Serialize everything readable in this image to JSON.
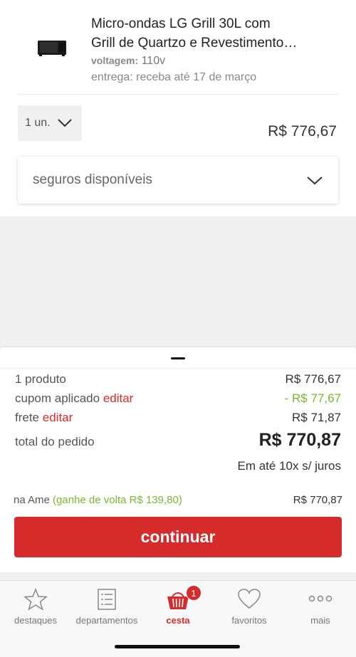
{
  "product": {
    "name_line1": "Micro-ondas LG Grill 30L com",
    "name_line2": "Grill de Quartzo e Revestimento…",
    "voltage_label": "voltagem:",
    "voltage_value": "110v",
    "delivery": "entrega: receba até 17 de março",
    "thumb_icon": "microwave-image",
    "quantity": "1 un.",
    "price": "R$ 776,67"
  },
  "insurance": {
    "label": "seguros disponíveis"
  },
  "summary": {
    "products_label": "1 produto",
    "products_value": "R$ 776,67",
    "coupon_label": "cupom aplicado",
    "coupon_edit": "editar",
    "coupon_value": "- R$ 77,67",
    "shipping_label": "frete",
    "shipping_edit": "editar",
    "shipping_value": "R$ 71,87",
    "total_label": "total do pedido",
    "total_value": "R$ 770,87",
    "installments": "Em até 10x s/ juros",
    "ame_label": "na Ame",
    "ame_cashback": "(ganhe de volta R$ 139,80)",
    "ame_value": "R$ 770,87",
    "continue_label": "continuar"
  },
  "tabs": [
    {
      "label": "destaques",
      "icon": "star-icon"
    },
    {
      "label": "departamentos",
      "icon": "list-icon"
    },
    {
      "label": "cesta",
      "icon": "basket-icon",
      "badge": "1",
      "active": true
    },
    {
      "label": "favoritos",
      "icon": "heart-icon"
    },
    {
      "label": "mais",
      "icon": "more-icon"
    }
  ],
  "colors": {
    "accent": "#d62b2b",
    "discount": "#7ab72e"
  }
}
